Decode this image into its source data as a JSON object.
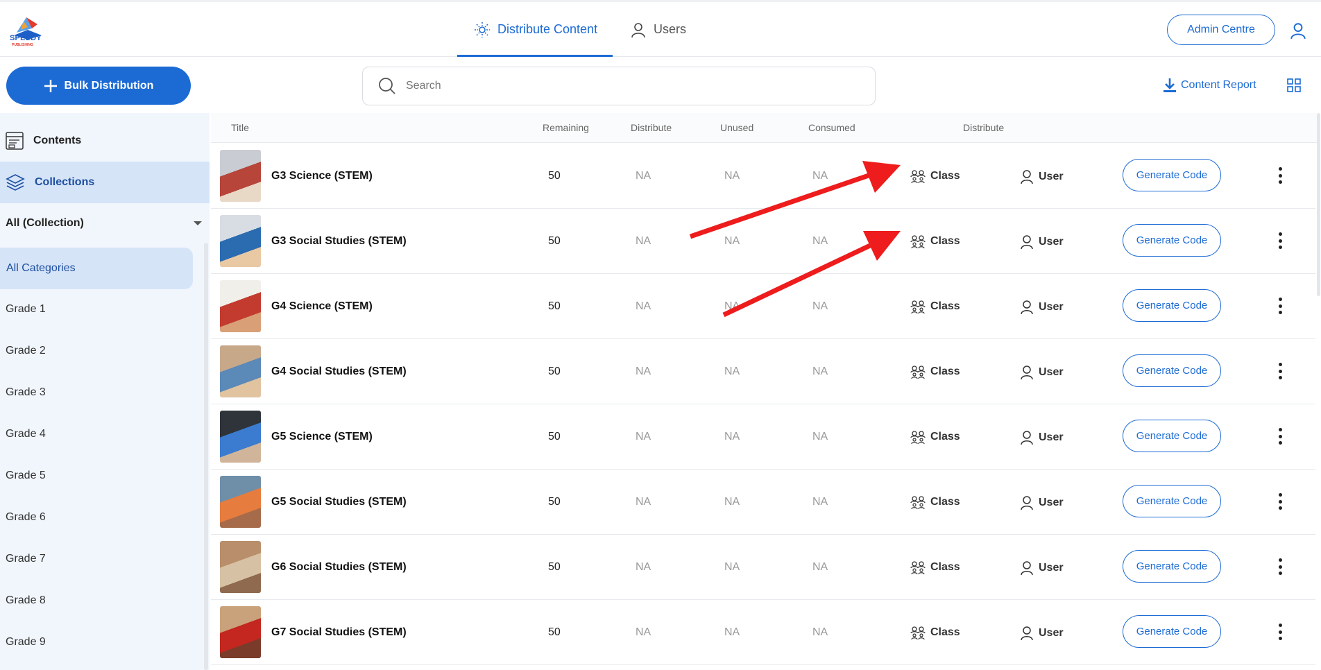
{
  "header": {
    "logo_text": "SPEEDY",
    "logo_sub": "PUBLISHING",
    "tabs": [
      {
        "label": "Distribute Content",
        "icon": "distribute-icon",
        "active": true
      },
      {
        "label": "Users",
        "icon": "user-icon",
        "active": false
      }
    ],
    "admin_label": "Admin Centre",
    "profile_icon": "user-icon"
  },
  "toolbar": {
    "bulk_label": "Bulk Distribution",
    "search_placeholder": "Search",
    "report_label": "Content Report"
  },
  "sidebar": {
    "items": [
      {
        "label": "Contents",
        "icon": "contents-icon"
      },
      {
        "label": "Collections",
        "icon": "layers-icon",
        "active": true
      }
    ],
    "filter_label": "All (Collection)",
    "categories": [
      "All Categories",
      "Grade 1",
      "Grade 2",
      "Grade 3",
      "Grade 4",
      "Grade 5",
      "Grade 6",
      "Grade 7",
      "Grade 8",
      "Grade 9"
    ]
  },
  "table": {
    "headers": [
      "Title",
      "Remaining",
      "Distribute",
      "Unused",
      "Consumed",
      "Distribute"
    ],
    "class_label": "Class",
    "user_label": "User",
    "generate_label": "Generate Code",
    "rows": [
      {
        "title": "G3 Science (STEM)",
        "remaining": "50",
        "distribute": "NA",
        "unused": "NA",
        "consumed": "NA"
      },
      {
        "title": "G3 Social Studies (STEM)",
        "remaining": "50",
        "distribute": "NA",
        "unused": "NA",
        "consumed": "NA"
      },
      {
        "title": "G4 Science (STEM)",
        "remaining": "50",
        "distribute": "NA",
        "unused": "NA",
        "consumed": "NA"
      },
      {
        "title": "G4 Social Studies (STEM)",
        "remaining": "50",
        "distribute": "NA",
        "unused": "NA",
        "consumed": "NA"
      },
      {
        "title": "G5 Science (STEM)",
        "remaining": "50",
        "distribute": "NA",
        "unused": "NA",
        "consumed": "NA"
      },
      {
        "title": "G5 Social Studies (STEM)",
        "remaining": "50",
        "distribute": "NA",
        "unused": "NA",
        "consumed": "NA"
      },
      {
        "title": "G6 Social Studies (STEM)",
        "remaining": "50",
        "distribute": "NA",
        "unused": "NA",
        "consumed": "NA"
      },
      {
        "title": "G7 Social Studies (STEM)",
        "remaining": "50",
        "distribute": "NA",
        "unused": "NA",
        "consumed": "NA"
      }
    ]
  },
  "colors": {
    "accent": "#1c6bd4",
    "sidebar_bg": "#f1f6fd",
    "sidebar_active": "#d6e4f8",
    "annotation_arrow": "#ee1c1c"
  }
}
